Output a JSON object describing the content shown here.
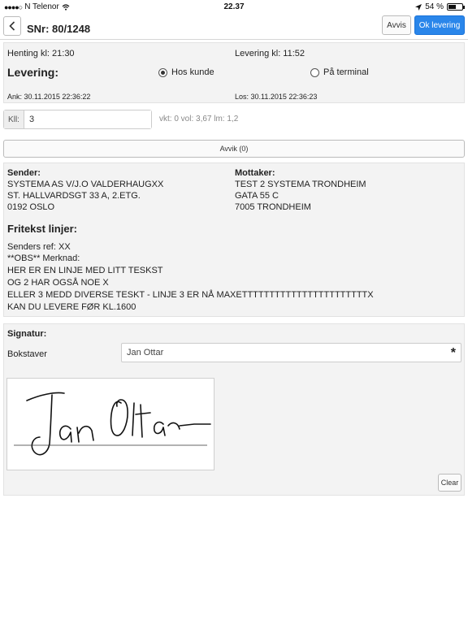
{
  "status_bar": {
    "carrier": "N Telenor",
    "time": "22.37",
    "battery": "54 %",
    "battery_level": 0.54,
    "icons": [
      "signal-dots-icon",
      "wifi-icon",
      "location-arrow-icon",
      "battery-icon"
    ]
  },
  "nav": {
    "title": "SNr: 80/1248",
    "back_icon": "chevron-left-icon",
    "avvis_label": "Avvis",
    "ok_label": "Ok levering"
  },
  "delivery": {
    "henting": "Henting kl: 21:30",
    "levering_time": "Levering kl: 11:52",
    "levering_label": "Levering:",
    "options": [
      {
        "label": "Hos kunde",
        "selected": true
      },
      {
        "label": "På terminal",
        "selected": false
      }
    ],
    "ank": "Ank: 30.11.2015 22:36:22",
    "los": "Los: 30.11.2015 22:36:23"
  },
  "kll": {
    "label": "Kll:",
    "value": "3",
    "info": "vkt: 0 vol: 3,67 lm: 1,2"
  },
  "avvik": {
    "label": "Avvik (0)"
  },
  "sender": {
    "heading": "Sender:",
    "lines": [
      "SYSTEMA AS V/J.O VALDERHAUGXX",
      "ST. HALLVARDSGT 33 A, 2.ETG.",
      "0192 OSLO"
    ]
  },
  "mottaker": {
    "heading": "Mottaker:",
    "lines": [
      "TEST 2 SYSTEMA TRONDHEIM",
      "GATA 55 C",
      "7005 TRONDHEIM"
    ]
  },
  "fritekst": {
    "heading": "Fritekst linjer:",
    "lines": [
      "Senders ref: XX",
      "**OBS** Merknad:",
      "HER ER EN LINJE MED LITT TESKST",
      "OG 2 HAR OGSÅ NOE X",
      "ELLER 3 MEDD DIVERSE TESKT - LINJE 3 ER NÅ MAXETTTTTTTTTTTTTTTTTTTTTTTX",
      "KAN DU LEVERE FØR KL.1600"
    ]
  },
  "signature": {
    "heading": "Signatur:",
    "bokstaver_label": "Bokstaver",
    "bokstaver_value": "Jan Ottar",
    "required_mark": "*",
    "drawn_name": "Jan Ottar",
    "clear_label": "Clear"
  }
}
